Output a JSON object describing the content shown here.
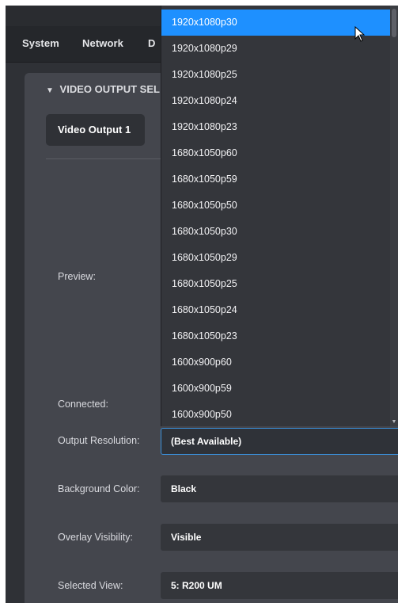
{
  "tabs": [
    "System",
    "Network",
    "D"
  ],
  "section": {
    "chevron": "chevron-down",
    "title": "VIDEO OUTPUT SEL"
  },
  "output_tab": "Video Output 1",
  "fields": {
    "preview_label": "Preview:",
    "connected_label": "Connected:",
    "output_resolution": {
      "label": "Output Resolution:",
      "value": "(Best Available)"
    },
    "background_color": {
      "label": "Background Color:",
      "value": "Black"
    },
    "overlay_visibility": {
      "label": "Overlay Visibility:",
      "value": "Visible"
    },
    "selected_view": {
      "label": "Selected View:",
      "value": "5: R200 UM"
    }
  },
  "dropdown": {
    "selected": "1920x1080p30",
    "options": [
      "1920x1080p30",
      "1920x1080p29",
      "1920x1080p25",
      "1920x1080p24",
      "1920x1080p23",
      "1680x1050p60",
      "1680x1050p59",
      "1680x1050p50",
      "1680x1050p30",
      "1680x1050p29",
      "1680x1050p25",
      "1680x1050p24",
      "1680x1050p23",
      "1600x900p60",
      "1600x900p59",
      "1600x900p50"
    ]
  },
  "colors": {
    "accent": "#1e90ff",
    "panel": "#44464d",
    "background": "#2f3136"
  },
  "icons": {
    "caret": "caret-down-icon",
    "cursor": "mouse-pointer-icon"
  }
}
